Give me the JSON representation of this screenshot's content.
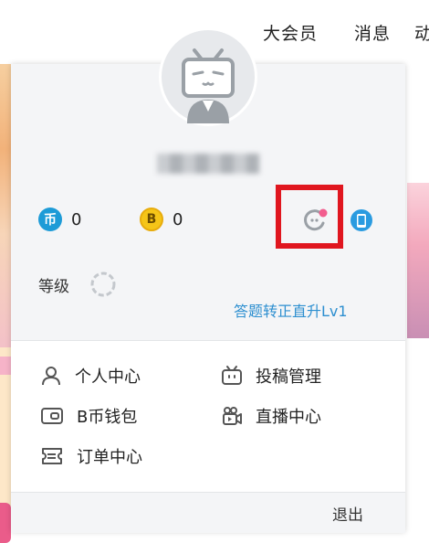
{
  "topbar": {
    "vip": "大会员",
    "messages": "消息",
    "more": "动"
  },
  "profile": {
    "avatar_icon": "tv-mascot-avatar",
    "username": "●●●●●●●"
  },
  "wallet": {
    "coins": "0",
    "bcoins": "0",
    "coin_symbol": "币",
    "bcoin_symbol": "B"
  },
  "level": {
    "label": "等级",
    "upgrade_link": "答题转正直升Lv1"
  },
  "menu": {
    "center": "个人中心",
    "upload": "投稿管理",
    "wallet": "B币钱包",
    "live": "直播中心",
    "orders": "订单中心"
  },
  "footer": {
    "logout": "退出"
  },
  "colors": {
    "accent_blue": "#2d8fd0",
    "coin_blue": "#1d9bd7",
    "bcoin_gold": "#f5c518",
    "highlight_red": "#e0161f",
    "badge_pink": "#f25d8e"
  }
}
